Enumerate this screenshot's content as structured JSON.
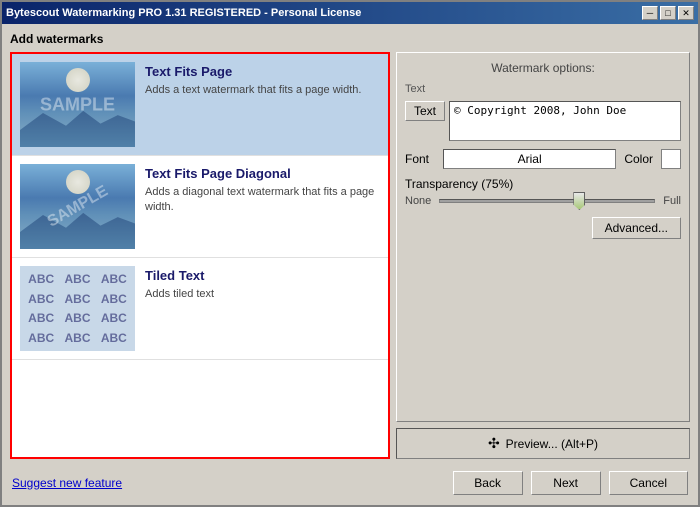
{
  "window": {
    "title": "Bytescout Watermarking PRO 1.31 REGISTERED - Personal License",
    "section_title": "Add watermarks"
  },
  "list_items": [
    {
      "id": "text-fits-page",
      "title": "Text Fits Page",
      "description": "Adds a text watermark that fits a page width.",
      "thumbnail_type": "sample",
      "selected": true
    },
    {
      "id": "text-fits-page-diagonal",
      "title": "Text Fits Page Diagonal",
      "description": "Adds a diagonal text watermark that fits a page width.",
      "thumbnail_type": "sample_diag",
      "selected": false
    },
    {
      "id": "tiled-text",
      "title": "Tiled Text",
      "description": "Adds tiled text",
      "thumbnail_type": "abc",
      "selected": false
    }
  ],
  "options": {
    "title": "Watermark options:",
    "text_section_label": "Text",
    "text_button_label": "Text",
    "text_value": "© Copyright 2008, John Doe",
    "font_label": "Font",
    "font_value": "Arial",
    "color_label": "Color",
    "transparency_label": "Transparency (75%)",
    "slider_min": "None",
    "slider_max": "Full",
    "advanced_label": "Advanced...",
    "preview_label": "Preview... (Alt+P)"
  },
  "bottom": {
    "suggest_link": "Suggest new feature",
    "back_button": "Back",
    "next_button": "Next",
    "cancel_button": "Cancel"
  },
  "icons": {
    "minimize": "─",
    "maximize": "□",
    "close": "✕",
    "preview": "✣",
    "scroll_up": "▲",
    "scroll_down": "▼"
  }
}
